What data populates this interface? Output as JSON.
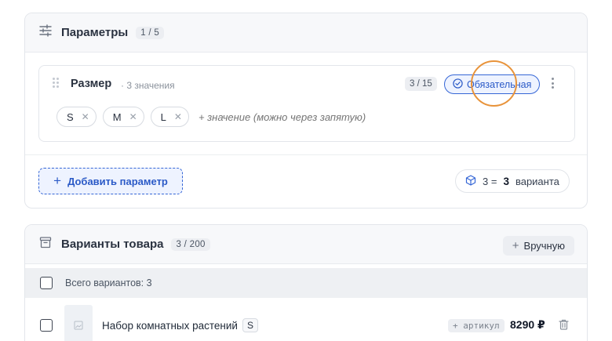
{
  "params": {
    "title": "Параметры",
    "counter": "1 / 5",
    "item": {
      "name": "Размер",
      "sub": "· 3 значения",
      "count": "3 / 15",
      "required_label": "Обязательная",
      "values": [
        "S",
        "M",
        "L"
      ],
      "value_placeholder": "+ значение (можно через запятую)"
    },
    "add_label": "Добавить параметр",
    "variants_summary": {
      "formula": "3 =",
      "count": "3",
      "unit": "варианта"
    }
  },
  "variants": {
    "title": "Варианты товара",
    "counter": "3 / 200",
    "manual_label": "Вручную",
    "all_label": "Всего вариантов: 3",
    "rows": [
      {
        "name": "Набор комнатных растений",
        "size": "S",
        "sku_label": "+ артикул",
        "price": "8290 ₽"
      }
    ]
  },
  "colors": {
    "accent": "#3566d6",
    "highlight": "#e8933a"
  }
}
